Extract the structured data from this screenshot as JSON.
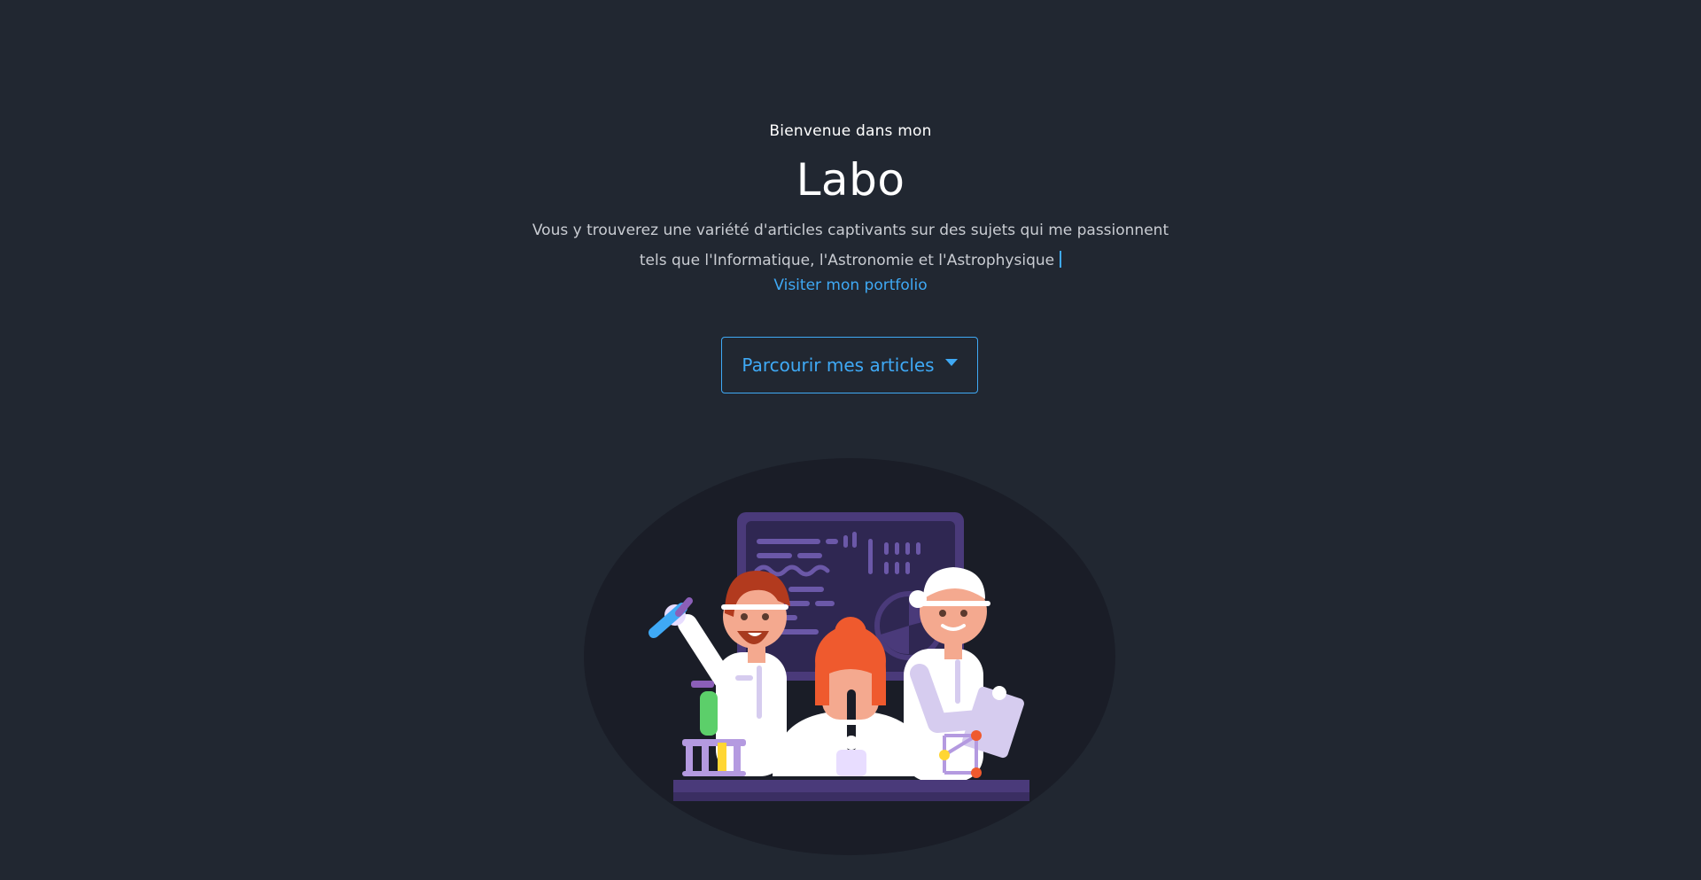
{
  "hero": {
    "welcome": "Bienvenue dans mon",
    "title": "Labo",
    "description_line1": "Vous y trouverez une variété d'articles captivants sur des sujets qui me passionnent",
    "description_line2": "tels que l'Informatique, l'Astronomie et l'Astrophysique",
    "portfolio_link": "Visiter mon portfolio",
    "browse_button": "Parcourir mes articles"
  },
  "colors": {
    "background": "#212731",
    "accent": "#3fa9f5",
    "text": "#ffffff",
    "muted_text": "#c9ccd2",
    "illustration_backdrop": "#1a1d27"
  },
  "icons": {
    "browse_button": "caret-down-icon"
  }
}
